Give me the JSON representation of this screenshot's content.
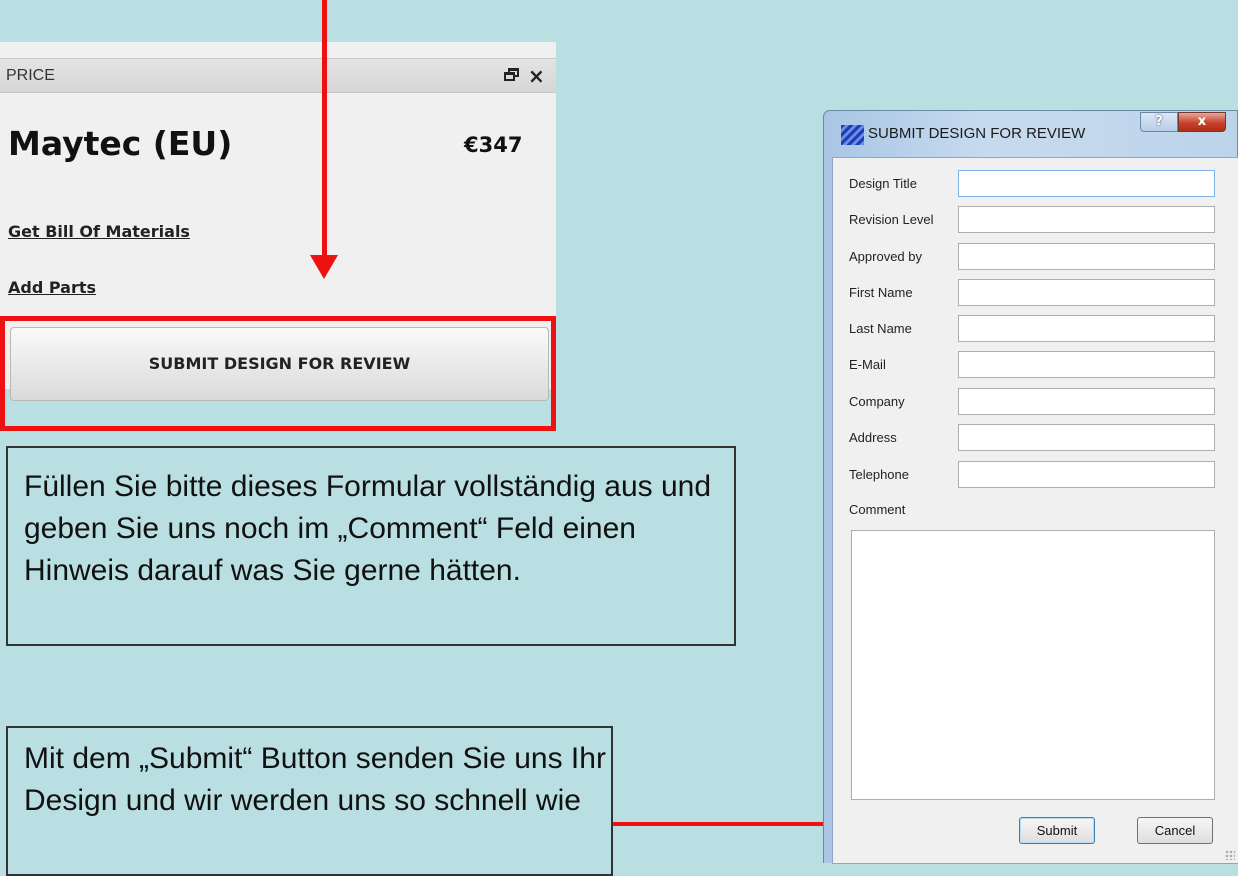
{
  "price_panel": {
    "header_title": "PRICE",
    "restore_icon": "window-restore-icon",
    "close_icon": "×",
    "vendor": "Maytec (EU)",
    "price": "€347",
    "links": {
      "bill_of_materials": "Get Bill Of Materials",
      "add_parts": "Add Parts"
    },
    "submit_button_label": "SUBMIT DESIGN FOR REVIEW",
    "highlight_color": "#ee1111"
  },
  "callouts": {
    "form_instructions": "Füllen Sie bitte dieses Formular vollständig aus und geben Sie uns noch im „Comment“ Feld einen Hinweis darauf was Sie gerne hätten.",
    "submit_instructions": "Mit dem „Submit“ Button senden Sie uns Ihr Design und wir werden uns so schnell wie"
  },
  "dialog": {
    "title": "SUBMIT DESIGN FOR REVIEW",
    "help_label": "?",
    "close_label": "x",
    "fields": [
      {
        "label": "Design Title",
        "value": ""
      },
      {
        "label": "Revision Level",
        "value": ""
      },
      {
        "label": "Approved by",
        "value": ""
      },
      {
        "label": "First Name",
        "value": ""
      },
      {
        "label": "Last Name",
        "value": ""
      },
      {
        "label": "E-Mail",
        "value": ""
      },
      {
        "label": "Company",
        "value": ""
      },
      {
        "label": "Address",
        "value": ""
      },
      {
        "label": "Telephone",
        "value": ""
      }
    ],
    "comment_label": "Comment",
    "comment_value": "",
    "submit_label": "Submit",
    "cancel_label": "Cancel"
  },
  "colors": {
    "background": "#b9dfe2",
    "arrow": "#ee1111"
  }
}
